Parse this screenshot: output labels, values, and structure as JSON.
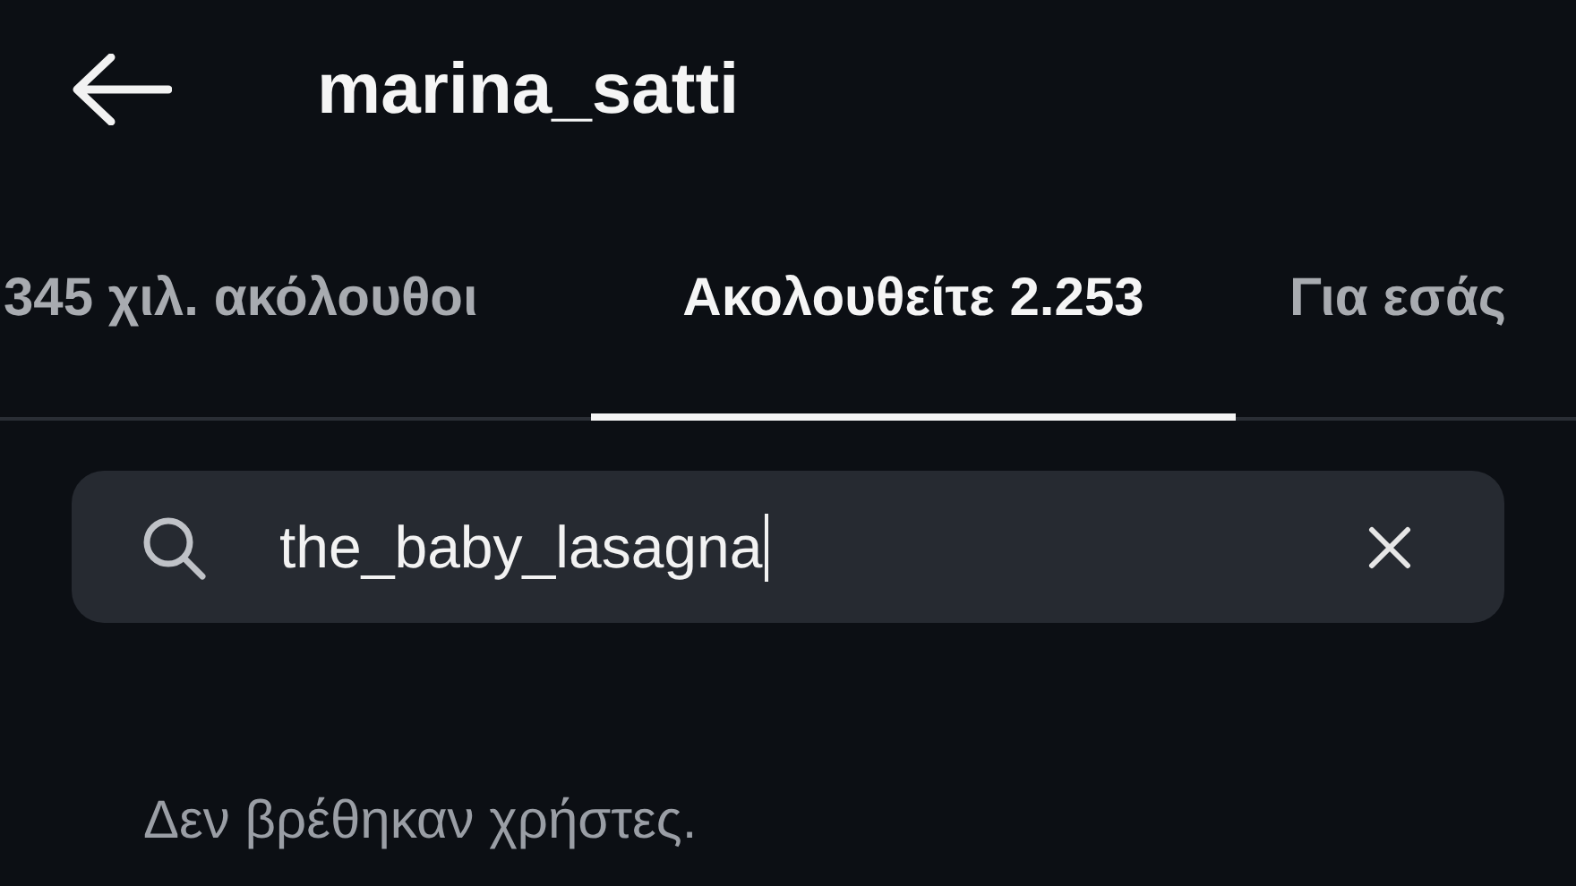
{
  "header": {
    "title": "marina_satti"
  },
  "tabs": [
    {
      "label": "345 χιλ. ακόλουθοι",
      "selected": false
    },
    {
      "label": "Ακολουθείτε 2.253",
      "selected": true
    },
    {
      "label": "Για εσάς",
      "selected": false
    }
  ],
  "search": {
    "value": "the_baby_lasagna"
  },
  "message": "Δεν βρέθηκαν χρήστες."
}
